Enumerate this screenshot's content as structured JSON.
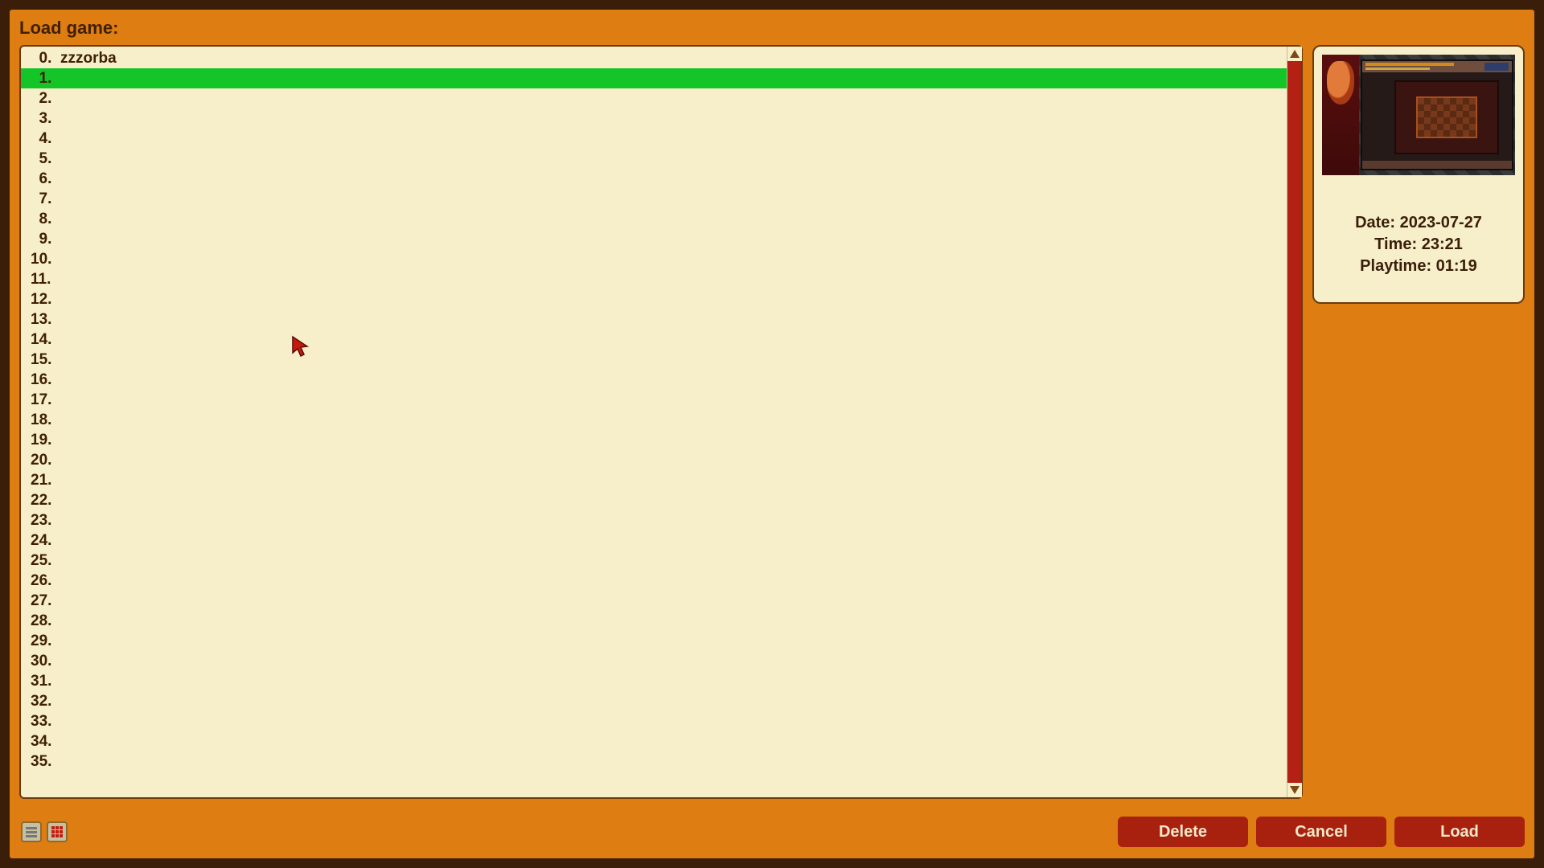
{
  "title": "Load game:",
  "slots": [
    {
      "n": 0,
      "name": "zzzorba",
      "selected": false
    },
    {
      "n": 1,
      "name": "",
      "selected": true
    },
    {
      "n": 2,
      "name": "",
      "selected": false
    },
    {
      "n": 3,
      "name": "",
      "selected": false
    },
    {
      "n": 4,
      "name": "",
      "selected": false
    },
    {
      "n": 5,
      "name": "",
      "selected": false
    },
    {
      "n": 6,
      "name": "",
      "selected": false
    },
    {
      "n": 7,
      "name": "",
      "selected": false
    },
    {
      "n": 8,
      "name": "",
      "selected": false
    },
    {
      "n": 9,
      "name": "",
      "selected": false
    },
    {
      "n": 10,
      "name": "",
      "selected": false
    },
    {
      "n": 11,
      "name": "",
      "selected": false
    },
    {
      "n": 12,
      "name": "",
      "selected": false
    },
    {
      "n": 13,
      "name": "",
      "selected": false
    },
    {
      "n": 14,
      "name": "",
      "selected": false
    },
    {
      "n": 15,
      "name": "",
      "selected": false
    },
    {
      "n": 16,
      "name": "",
      "selected": false
    },
    {
      "n": 17,
      "name": "",
      "selected": false
    },
    {
      "n": 18,
      "name": "",
      "selected": false
    },
    {
      "n": 19,
      "name": "",
      "selected": false
    },
    {
      "n": 20,
      "name": "",
      "selected": false
    },
    {
      "n": 21,
      "name": "",
      "selected": false
    },
    {
      "n": 22,
      "name": "",
      "selected": false
    },
    {
      "n": 23,
      "name": "",
      "selected": false
    },
    {
      "n": 24,
      "name": "",
      "selected": false
    },
    {
      "n": 25,
      "name": "",
      "selected": false
    },
    {
      "n": 26,
      "name": "",
      "selected": false
    },
    {
      "n": 27,
      "name": "",
      "selected": false
    },
    {
      "n": 28,
      "name": "",
      "selected": false
    },
    {
      "n": 29,
      "name": "",
      "selected": false
    },
    {
      "n": 30,
      "name": "",
      "selected": false
    },
    {
      "n": 31,
      "name": "",
      "selected": false
    },
    {
      "n": 32,
      "name": "",
      "selected": false
    },
    {
      "n": 33,
      "name": "",
      "selected": false
    },
    {
      "n": 34,
      "name": "",
      "selected": false
    },
    {
      "n": 35,
      "name": "",
      "selected": false
    }
  ],
  "preview": {
    "date_label": "Date: 2023-07-27",
    "time_label": "Time: 23:21",
    "playtime_label": "Playtime: 01:19"
  },
  "buttons": {
    "delete": "Delete",
    "cancel": "Cancel",
    "load": "Load"
  }
}
